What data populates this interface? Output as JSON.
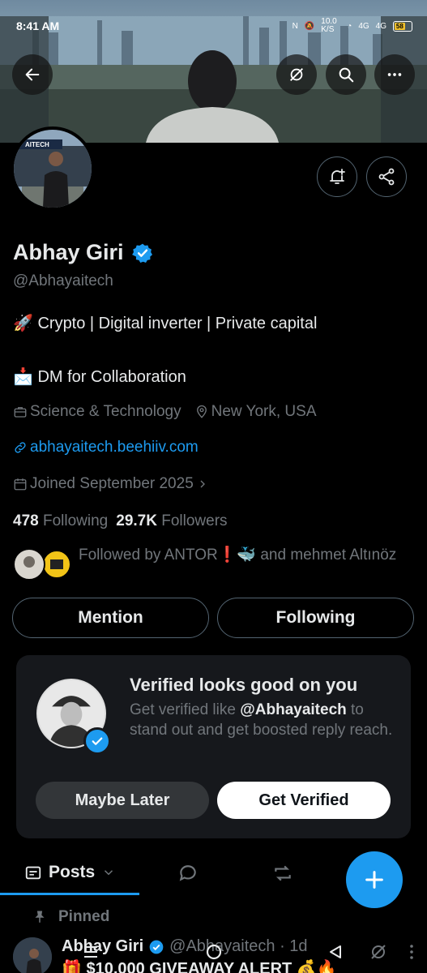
{
  "status_bar": {
    "time": "8:41 AM",
    "network_speed": "10.0 K/S",
    "signal1": "4G",
    "signal2": "4G",
    "battery": "58"
  },
  "profile": {
    "name": "Abhay Giri",
    "handle": "@Abhayaitech",
    "bio_line1": "🚀  Crypto  | Digital inverter |  Private capital",
    "bio_line2": "📩 DM for Collaboration",
    "category": "Science & Technology",
    "location": "New York, USA",
    "website": "abhayaitech.beehiiv.com",
    "joined": "Joined September 2025",
    "following_count": "478",
    "following_label": "Following",
    "followers_count": "29.7K",
    "followers_label": "Followers",
    "followed_by": "Followed by ANTOR❗🐳 and mehmet Altınöz",
    "avatar_logo_text": "AITECH"
  },
  "actions": {
    "mention": "Mention",
    "following": "Following"
  },
  "verify_card": {
    "title": "Verified looks good on you",
    "desc_prefix": "Get verified like ",
    "desc_handle": "@Abhayaitech",
    "desc_suffix": " to stand out and get boosted reply reach.",
    "maybe_later": "Maybe Later",
    "get_verified": "Get Verified"
  },
  "tabs": {
    "posts": "Posts"
  },
  "pinned_post": {
    "pinned_label": "Pinned",
    "name": "Abhay Giri",
    "handle": "@Abhayaitech · 1d",
    "text": "🎁 $10,000 GIVEAWAY ALERT 💰🔥"
  },
  "colors": {
    "accent": "#1d9bf0",
    "background": "#000000",
    "muted_text": "#71767b"
  }
}
